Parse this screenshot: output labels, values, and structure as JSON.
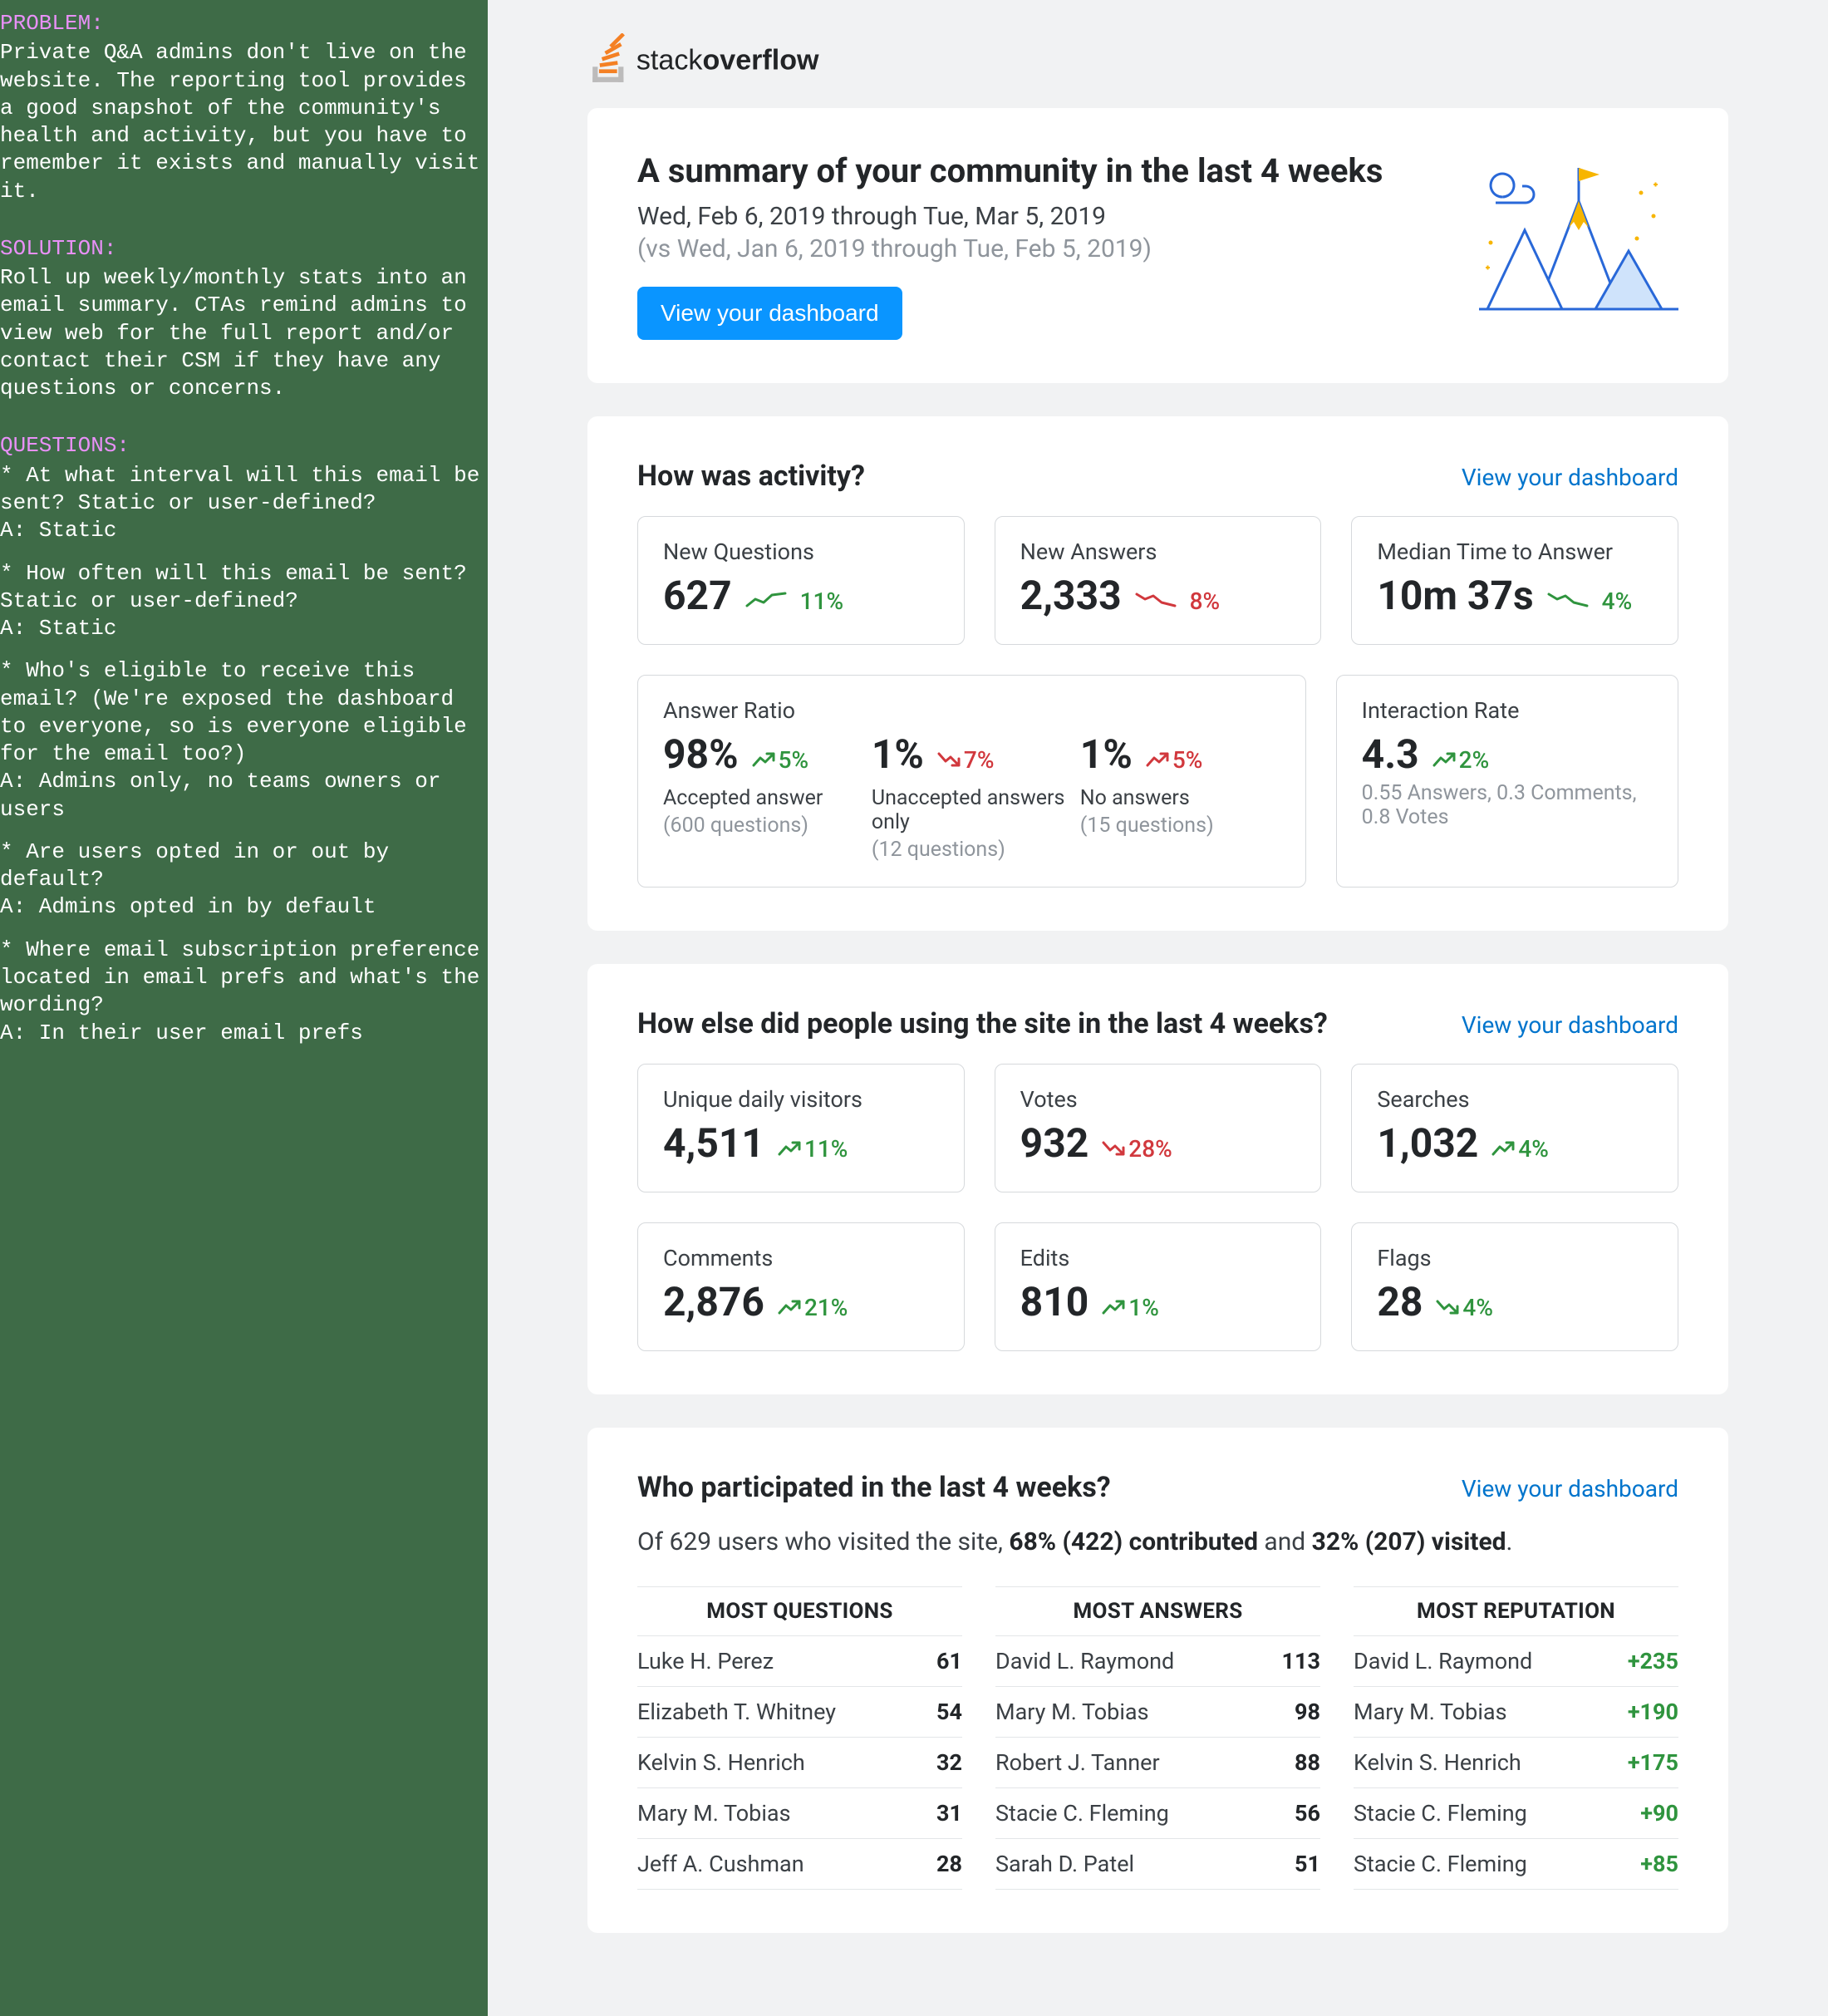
{
  "sidebar": {
    "problem_label": "PROBLEM:",
    "problem_text": "Private Q&A admins don't live on the website. The reporting tool provides a good snapshot of the community's health and activity, but you have to remember it exists and manually visit it.",
    "solution_label": "SOLUTION:",
    "solution_text": "Roll up weekly/monthly stats into an email summary. CTAs remind admins to view web for the full report and/or contact their CSM if they have any questions or concerns.",
    "questions_label": "QUESTIONS:",
    "questions": [
      {
        "q": "* At what interval will this email be sent? Static or user-defined?",
        "a": "A: Static"
      },
      {
        "q": "* How often will this email be sent? Static or user-defined?",
        "a": "A: Static"
      },
      {
        "q": "* Who's eligible to receive this email? (We're exposed the dashboard to everyone, so is everyone eligible for the email too?)",
        "a": "A: Admins only, no teams owners or users"
      },
      {
        "q": "* Are users opted in or out by default?",
        "a": "A: Admins opted in by default"
      },
      {
        "q": "* Where email subscription preference located in email prefs and what's the wording?",
        "a": "A: In their user email prefs"
      }
    ]
  },
  "hero": {
    "title": "A summary of your community in the last 4 weeks",
    "date_range": "Wed, Feb 6, 2019 through Tue, Mar 5, 2019",
    "compare_range": "(vs Wed, Jan 6, 2019 through Tue, Feb 5, 2019)",
    "cta": "View your dashboard"
  },
  "sections": {
    "activity": {
      "title": "How was activity?",
      "link": "View your dashboard",
      "row1": [
        {
          "title": "New Questions",
          "value": "627",
          "delta": "11%",
          "dir": "up",
          "trend": true
        },
        {
          "title": "New Answers",
          "value": "2,333",
          "delta": "8%",
          "dir": "down",
          "trend": true
        },
        {
          "title": "Median Time to Answer",
          "value": "10m 37s",
          "delta": "4%",
          "dir": "down-green",
          "trend": true
        }
      ],
      "ratio": {
        "title": "Answer Ratio",
        "cols": [
          {
            "value": "98%",
            "delta": "5%",
            "dir": "up",
            "label": "Accepted answer",
            "meta": "(600 questions)"
          },
          {
            "value": "1%",
            "delta": "7%",
            "dir": "down",
            "label": "Unaccepted answers only",
            "meta": "(12 questions)"
          },
          {
            "value": "1%",
            "delta": "5%",
            "dir": "up-red",
            "label": "No answers",
            "meta": "(15 questions)"
          }
        ]
      },
      "interaction": {
        "title": "Interaction Rate",
        "value": "4.3",
        "delta": "2%",
        "dir": "up",
        "meta": "0.55 Answers, 0.3 Comments, 0.8 Votes"
      }
    },
    "usage": {
      "title": "How else did people using the site in the last 4 weeks?",
      "link": "View your dashboard",
      "row1": [
        {
          "title": "Unique daily visitors",
          "value": "4,511",
          "delta": "11%",
          "dir": "up"
        },
        {
          "title": "Votes",
          "value": "932",
          "delta": "28%",
          "dir": "down"
        },
        {
          "title": "Searches",
          "value": "1,032",
          "delta": "4%",
          "dir": "up"
        }
      ],
      "row2": [
        {
          "title": "Comments",
          "value": "2,876",
          "delta": "21%",
          "dir": "up"
        },
        {
          "title": "Edits",
          "value": "810",
          "delta": "1%",
          "dir": "up"
        },
        {
          "title": "Flags",
          "value": "28",
          "delta": "4%",
          "dir": "down-green"
        }
      ]
    },
    "participation": {
      "title": "Who participated in the last 4 weeks?",
      "link": "View your dashboard",
      "intro_prefix": "Of 629 users who visited the site, ",
      "intro_bold1": "68% (422) contributed",
      "intro_mid": " and ",
      "intro_bold2": "32% (207) visited",
      "intro_suffix": ".",
      "cols": [
        {
          "head": "MOST QUESTIONS",
          "rows": [
            {
              "name": "Luke H. Perez",
              "val": "61"
            },
            {
              "name": "Elizabeth T. Whitney",
              "val": "54"
            },
            {
              "name": "Kelvin S. Henrich",
              "val": "32"
            },
            {
              "name": "Mary M. Tobias",
              "val": "31"
            },
            {
              "name": "Jeff A. Cushman",
              "val": "28"
            }
          ]
        },
        {
          "head": "MOST ANSWERS",
          "rows": [
            {
              "name": "David L. Raymond",
              "val": "113"
            },
            {
              "name": "Mary M. Tobias",
              "val": "98"
            },
            {
              "name": "Robert J. Tanner",
              "val": "88"
            },
            {
              "name": "Stacie C. Fleming",
              "val": "56"
            },
            {
              "name": "Sarah D. Patel",
              "val": "51"
            }
          ]
        },
        {
          "head": "MOST REPUTATION",
          "rep": true,
          "rows": [
            {
              "name": "David L. Raymond",
              "val": "+235"
            },
            {
              "name": "Mary M. Tobias",
              "val": "+190"
            },
            {
              "name": "Kelvin S. Henrich",
              "val": "+175"
            },
            {
              "name": "Stacie C. Fleming",
              "val": "+90"
            },
            {
              "name": "Stacie C. Fleming",
              "val": "+85"
            }
          ]
        }
      ]
    }
  }
}
